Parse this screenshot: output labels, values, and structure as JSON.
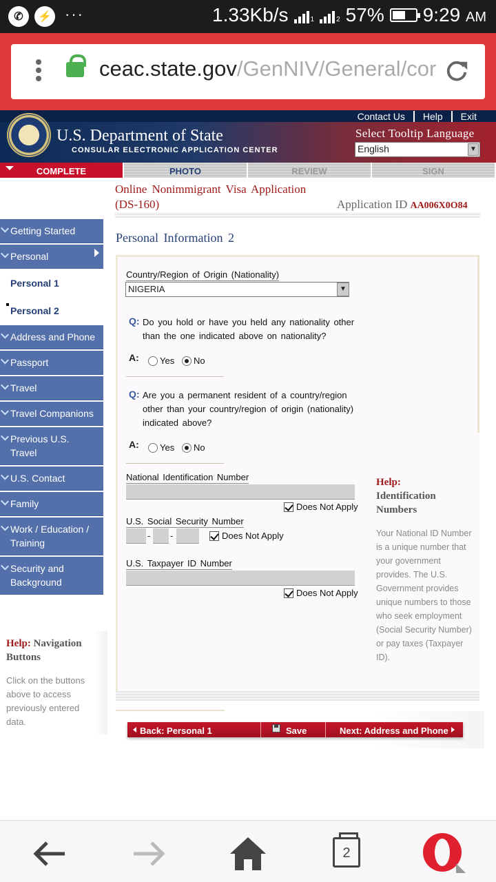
{
  "status_bar": {
    "speed": "1.33Kb/s",
    "sim1": "1",
    "sim2": "2",
    "battery_percent": "57%",
    "battery_level": 0.57,
    "time": "9:29",
    "ampm": "AM",
    "dots": "···"
  },
  "browser": {
    "url_domain": "ceac.state.gov",
    "url_path": "/GenNIV/General/cor",
    "tab_count": "2"
  },
  "site": {
    "title": "U.S. Department of State",
    "subtitle": "CONSULAR ELECTRONIC APPLICATION CENTER",
    "links": [
      "Contact Us",
      "Help",
      "Exit"
    ],
    "tooltip_language_label": "Select Tooltip Language",
    "language": "English"
  },
  "tabs": [
    {
      "label": "COMPLETE"
    },
    {
      "label": "PHOTO"
    },
    {
      "label": "REVIEW"
    },
    {
      "label": "SIGN"
    }
  ],
  "application": {
    "title_line1": "Online Nonimmigrant Visa Application",
    "title_line2": "(DS-160)",
    "id_label": "Application ID",
    "id_value": "AA006X0O84",
    "section_title": "Personal Information 2"
  },
  "sidebar": {
    "items": [
      {
        "label": "Getting Started"
      },
      {
        "label": "Personal"
      },
      {
        "label": "Personal 1"
      },
      {
        "label": "Personal 2"
      },
      {
        "label": "Address and Phone"
      },
      {
        "label": "Passport"
      },
      {
        "label": "Travel"
      },
      {
        "label": "Travel Companions"
      },
      {
        "label": "Previous U.S. Travel"
      },
      {
        "label": "U.S. Contact"
      },
      {
        "label": "Family"
      },
      {
        "label": "Work / Education / Training"
      },
      {
        "label": "Security and Background"
      }
    ],
    "help_prefix": "Help:",
    "help_title": "Navigation Buttons",
    "help_text": "Click on the buttons above to access previously entered data."
  },
  "form": {
    "nationality_label": "Country/Region of Origin (Nationality)",
    "nationality_value": "NIGERIA",
    "q_mark": "Q:",
    "a_mark": "A:",
    "q1": "Do you hold or have you held any nationality other than the one indicated above on nationality?",
    "q2": "Are you a permanent resident of a country/region other than your country/region of origin (nationality) indicated above?",
    "yes": "Yes",
    "no": "No",
    "national_id_label": "National Identification Number",
    "ssn_label": "U.S. Social Security Number",
    "taxpayer_label": "U.S. Taxpayer ID Number",
    "does_not_apply": "Does Not Apply",
    "dash": "-"
  },
  "help_right": {
    "prefix": "Help:",
    "title": "Identification Numbers",
    "text": "Your National ID Number is a unique number that your government provides. The U.S. Government provides unique numbers to those who seek employment (Social Security Number) or pay taxes (Taxpayer ID)."
  },
  "buttons": {
    "back": "Back: Personal 1",
    "save": "Save",
    "next": "Next: Address and Phone"
  }
}
